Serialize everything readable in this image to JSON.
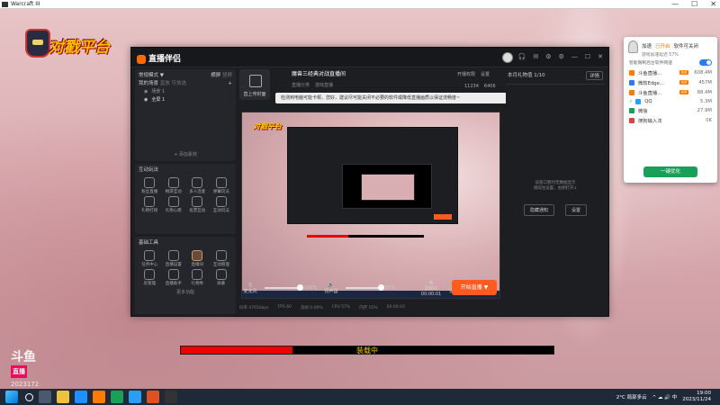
{
  "window": {
    "title": "Warcraft III",
    "min": "—",
    "max": "☐",
    "close": "✕"
  },
  "game": {
    "logo_text": "对戳平台",
    "loading_text": "装载中",
    "loading_progress": 0.3,
    "watermark": {
      "brand": "斗鱼",
      "sub": "直播",
      "id": "2023172"
    }
  },
  "app": {
    "name": "直播伴侣",
    "top_icons": [
      "🎧",
      "✉",
      "⚙",
      "⚙",
      "—",
      "☐",
      "✕"
    ],
    "left": {
      "mode_label": "常规模式 ▼",
      "mode_tabs": [
        "横屏",
        "竖屏"
      ],
      "scene_tabs": [
        "我的场景",
        "直放",
        "可放选"
      ],
      "scenes": [
        "场景 1",
        "全屏 1"
      ],
      "add_source": "+ 添加素材",
      "interact_title": "互动玩法",
      "interact_tools": [
        "粉丝直播",
        "畅游互动",
        "多人连麦",
        "弹幕玩法",
        "礼物打榜",
        "礼物心愿",
        "投票互动",
        "互动玩法"
      ],
      "base_title": "基础工具",
      "base_tools": [
        "任务中心",
        "直播设置",
        "直播间",
        "互动管理",
        "房管理",
        "直播助手",
        "礼物秀",
        "屏蔽"
      ],
      "more": "更多功能"
    },
    "center": {
      "upload_label": "直上传封面",
      "room_title": "魔兽三经典对战直播间",
      "room_sub": [
        "直播分类",
        "游戏直播"
      ],
      "stats": [
        "开播权限",
        "设置"
      ],
      "notice": "检测到电脑可能卡顿，您好，建议尽可能关闭不必要的软件或降低直播画质以保证流畅度~",
      "viewers": "11234",
      "likes": "6406",
      "mic_label": "麦克风",
      "mic_pct": "100%",
      "spk_label": "扬声器",
      "spk_pct": "50%",
      "record_label": "录制中",
      "record_time": "00:00:01",
      "settings_label": "设置",
      "start_label": "开始直播 ▼"
    },
    "right": {
      "tab_title": "本月礼物值 1/10",
      "tab_btn": "详情",
      "empty_text": "该窗口暂时无数据显示\n请前往设置，右侧打开↓",
      "btn1": "隐藏通知",
      "btn2": "设置"
    },
    "status": [
      "码率 4765kbps",
      "FPS 60",
      "丢帧 0.00%",
      "CPU 57%",
      "内存 55%",
      "00:00:43"
    ]
  },
  "popup": {
    "title_a": "加速",
    "title_accent": "已开启",
    "title_b": "软件可关闭",
    "sub": "游戏加速延迟 57%",
    "toggle_label": "智能限制后台软件网速",
    "rows": [
      {
        "name": "斗鱼直播...",
        "tag": "VIP",
        "speed": "608.4M",
        "color": "#ff7a00"
      },
      {
        "name": "微软Edge...",
        "tag": "VIP",
        "speed": "457M",
        "color": "#2a7cf0"
      },
      {
        "name": "斗鱼直播...",
        "tag": "VIP",
        "speed": "88.4M",
        "color": "#ff7a00"
      },
      {
        "name": "QQ",
        "tag": "",
        "speed": "5.3M",
        "color": "#2a9df4"
      },
      {
        "name": "微信",
        "tag": "",
        "speed": "27.9M",
        "color": "#18a058"
      },
      {
        "name": "搜狗输入法",
        "tag": "",
        "speed": "0K",
        "color": "#e04040"
      }
    ],
    "button": "一键优化"
  },
  "taskbar": {
    "weather": "2°C 局部多云",
    "time": "19:00",
    "date": "2023/11/24"
  }
}
